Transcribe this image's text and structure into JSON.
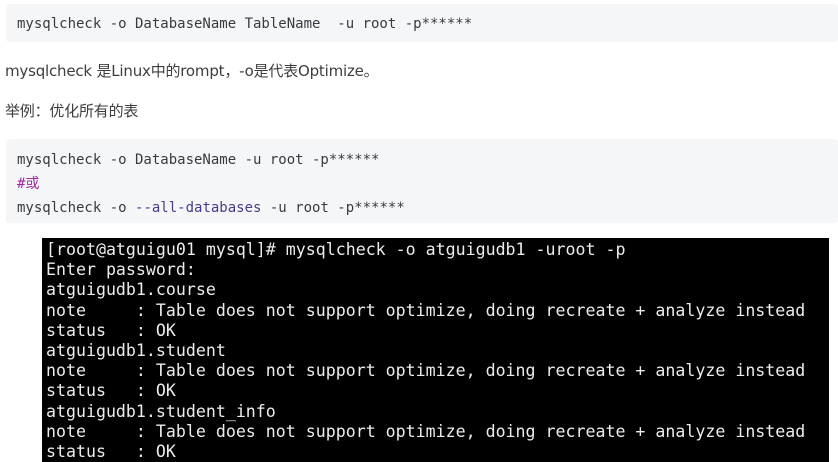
{
  "code_block_1": {
    "lines": [
      "mysqlcheck -o DatabaseName TableName  -u root -p******"
    ]
  },
  "paragraphs": {
    "description": "mysqlcheck 是Linux中的rompt，-o是代表Optimize。",
    "example_heading": "举例：优化所有的表"
  },
  "code_block_2": {
    "line1": "mysqlcheck -o DatabaseName -u root -p******",
    "comment": "#或",
    "line3_prefix": "mysqlcheck -o ",
    "line3_keyword": "--all-databases",
    "line3_suffix": " -u root -p******"
  },
  "terminal": {
    "lines": [
      "[root@atguigu01 mysql]# mysqlcheck -o atguigudb1 -uroot -p",
      "Enter password:",
      "atguigudb1.course",
      "note     : Table does not support optimize, doing recreate + analyze instead",
      "status   : OK",
      "atguigudb1.student",
      "note     : Table does not support optimize, doing recreate + analyze instead",
      "status   : OK",
      "atguigudb1.student_info",
      "note     : Table does not support optimize, doing recreate + analyze instead",
      "status   : OK"
    ]
  },
  "colors": {
    "code_background": "#f5f6f7",
    "code_text": "#383a42",
    "comment": "#a626a4",
    "terminal_background": "#000000",
    "terminal_text": "#ececec"
  }
}
